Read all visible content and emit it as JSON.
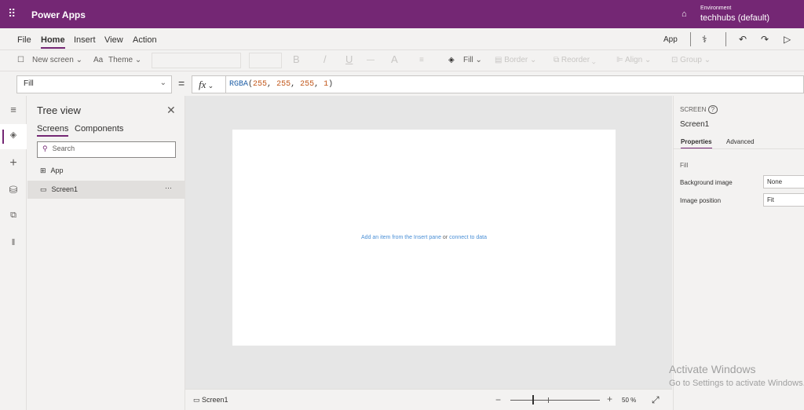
{
  "title_bar": {
    "app_name": "Power Apps",
    "environment_label": "Environment",
    "environment_name": "techhubs (default)"
  },
  "menu": [
    "File",
    "Home",
    "Insert",
    "View",
    "Action"
  ],
  "menu_active": "Home",
  "right_actions": {
    "app_label": "App"
  },
  "toolbar": {
    "new_screen": "New screen",
    "theme": "Theme",
    "bold": "B",
    "italic": "/",
    "underline": "U",
    "font_color": "A",
    "fill": "Fill",
    "border": "Border",
    "reorder": "Reorder",
    "align": "Align",
    "group": "Group"
  },
  "formula_bar": {
    "property": "Fill",
    "equals": "=",
    "fx": "fx",
    "formula_fn": "RGBA",
    "formula_args": [
      "255",
      "255",
      "255",
      "1"
    ]
  },
  "tree_view": {
    "title": "Tree view",
    "tabs": [
      "Screens",
      "Components"
    ],
    "search_placeholder": "Search",
    "items": [
      {
        "label": "App"
      },
      {
        "label": "Screen1",
        "more": "···"
      }
    ]
  },
  "canvas": {
    "hint_link1": "Add an item from the Insert pane",
    "hint_or": "or",
    "hint_link2": "connect to data"
  },
  "bottom_bar": {
    "screen": "Screen1",
    "zoom": "50",
    "zoom_unit": "%",
    "zoom_minus": "−",
    "zoom_plus": "+"
  },
  "properties_panel": {
    "kind": "SCREEN",
    "name": "Screen1",
    "tabs": [
      "Properties",
      "Advanced"
    ],
    "section": "Fill",
    "rows": [
      {
        "label": "Background image",
        "value": "None"
      },
      {
        "label": "Image position",
        "value": "Fit"
      }
    ]
  },
  "watermark": {
    "line1": "Activate Windows",
    "line2": "Go to Settings to activate Windows."
  },
  "colors": {
    "brand": "#742774",
    "link": "#4a8fd6"
  }
}
